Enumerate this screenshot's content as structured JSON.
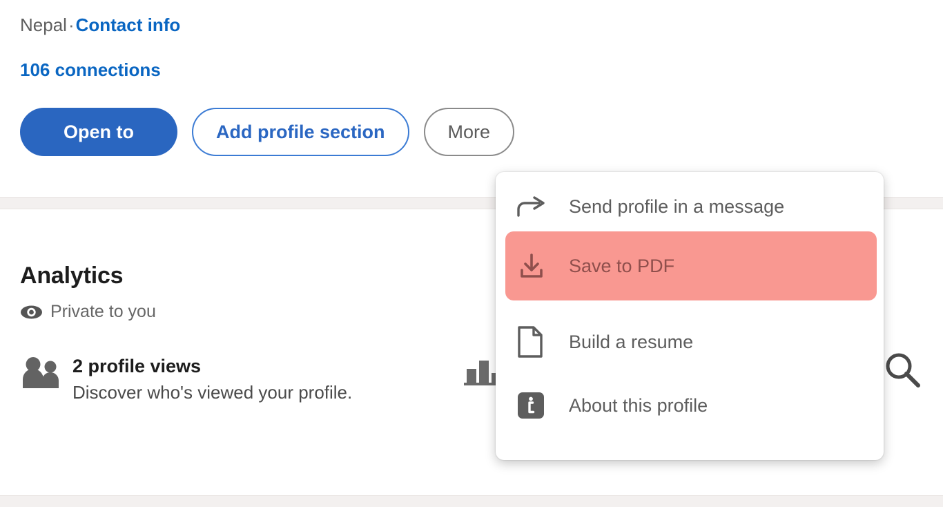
{
  "profile": {
    "location": "Nepal",
    "separator": "·",
    "contact_link": "Contact info",
    "connections": "106 connections"
  },
  "actions": {
    "open_to": "Open to",
    "add_profile_section": "Add profile section",
    "more": "More"
  },
  "analytics": {
    "title": "Analytics",
    "visibility": "Private to you",
    "visibility_icon": "eye-icon",
    "stats": [
      {
        "icon": "people-icon",
        "headline": "2 profile views",
        "description": "Discover who's viewed your profile."
      },
      {
        "icon": "bar-chart-icon",
        "headline": "",
        "description": ""
      },
      {
        "icon": "search-icon",
        "headline": "",
        "description": ""
      }
    ]
  },
  "more_menu": {
    "items": [
      {
        "label": "Send profile in a message",
        "icon": "share-arrow-icon",
        "highlighted": false
      },
      {
        "label": "Save to PDF",
        "icon": "download-icon",
        "highlighted": true
      },
      {
        "label": "Build a resume",
        "icon": "document-icon",
        "highlighted": false
      },
      {
        "label": "About this profile",
        "icon": "info-icon",
        "highlighted": false
      }
    ]
  },
  "colors": {
    "brand_blue": "#0a66c2",
    "primary_button": "#2a66c0",
    "highlight_overlay": "#fa7b72",
    "highlight_text": "#8f4f4c",
    "menu_text": "#5d5d5d",
    "icon_gray": "#5f5f5f",
    "divider_band": "#f3f0ef"
  }
}
